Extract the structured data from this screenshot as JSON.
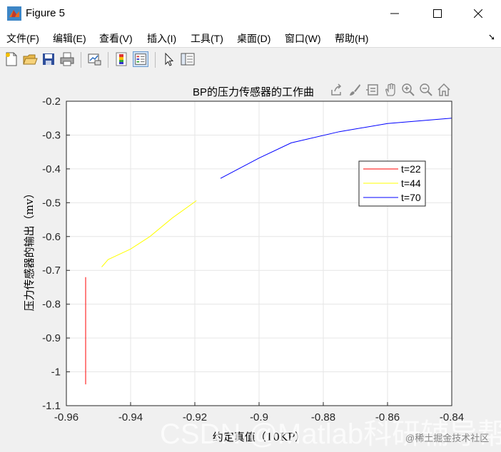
{
  "window": {
    "title": "Figure 5"
  },
  "menu": [
    "文件(F)",
    "编辑(E)",
    "查看(V)",
    "插入(I)",
    "工具(T)",
    "桌面(D)",
    "窗口(W)",
    "帮助(H)"
  ],
  "toolbar_icons": [
    "new-figure-icon",
    "open-file-icon",
    "save-icon",
    "print-icon",
    "link-plot-icon",
    "colorbar-icon",
    "legend-icon",
    "pointer-icon",
    "property-inspector-icon"
  ],
  "axes_toolbar_icons": [
    "export-icon",
    "brush-icon",
    "data-tips-icon",
    "pan-icon",
    "zoom-in-icon",
    "zoom-out-icon",
    "home-icon"
  ],
  "colors": {
    "t22": "#ff0000",
    "t44": "#ffff00",
    "t70": "#0000ff"
  },
  "chart_data": {
    "type": "line",
    "title": "BP的压力传感器的工作曲",
    "xlabel": "约定真值（10KP）",
    "ylabel": "压力传感器的输出（mv）",
    "xlim": [
      -0.96,
      -0.84
    ],
    "ylim": [
      -1.1,
      -0.2
    ],
    "xticks": [
      "-0.96",
      "-0.94",
      "-0.92",
      "-0.9",
      "-0.88",
      "-0.86",
      "-0.84"
    ],
    "yticks": [
      "-0.2",
      "-0.3",
      "-0.4",
      "-0.5",
      "-0.6",
      "-0.7",
      "-0.8",
      "-0.9",
      "-1",
      "-1.1"
    ],
    "grid": true,
    "legend_position": "top-right",
    "series": [
      {
        "name": "t=22",
        "color": "#ff0000",
        "points": [
          [
            -0.954,
            -0.72
          ],
          [
            -0.954,
            -1.037
          ]
        ]
      },
      {
        "name": "t=44",
        "color": "#ffff00",
        "points": [
          [
            -0.949,
            -0.69
          ],
          [
            -0.947,
            -0.668
          ],
          [
            -0.94,
            -0.637
          ],
          [
            -0.934,
            -0.6
          ],
          [
            -0.927,
            -0.545
          ],
          [
            -0.9195,
            -0.494
          ]
        ]
      },
      {
        "name": "t=70",
        "color": "#0000ff",
        "points": [
          [
            -0.912,
            -0.428
          ],
          [
            -0.9,
            -0.368
          ],
          [
            -0.89,
            -0.323
          ],
          [
            -0.875,
            -0.29
          ],
          [
            -0.86,
            -0.266
          ],
          [
            -0.84,
            -0.25
          ]
        ]
      }
    ]
  },
  "watermarks": {
    "main": "CSDN @Matlab科研辅导帮",
    "corner": "@稀土掘金技术社区"
  }
}
